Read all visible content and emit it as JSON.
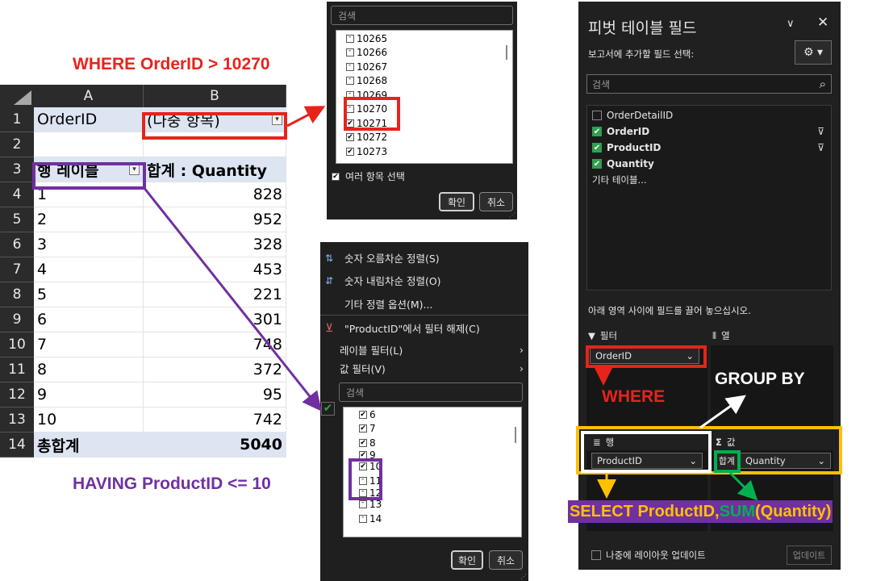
{
  "annotations": {
    "where_title": "WHERE OrderID > 10270",
    "having_title": "HAVING ProductID <= 10",
    "where_label": "WHERE",
    "group_by_label": "GROUP BY",
    "select_prefix": "SELECT ProductID, ",
    "select_sum": "SUM",
    "select_suffix": "(Quantity)",
    "colors": {
      "red": "#e8231b",
      "purple": "#7030a0",
      "amber": "#ffc000",
      "green": "#00b050",
      "white": "#ffffff"
    }
  },
  "grid": {
    "columns": [
      "A",
      "B"
    ],
    "rows": [
      "1",
      "2",
      "3",
      "4",
      "5",
      "6",
      "7",
      "8",
      "9",
      "10",
      "11",
      "12",
      "13",
      "14"
    ],
    "filter_label": "OrderID",
    "filter_value": "(다중 항목)",
    "row_labels_header": "행 레이블",
    "sum_header": "합계 : Quantity",
    "data": [
      {
        "label": "1",
        "value": "828"
      },
      {
        "label": "2",
        "value": "952"
      },
      {
        "label": "3",
        "value": "328"
      },
      {
        "label": "4",
        "value": "453"
      },
      {
        "label": "5",
        "value": "221"
      },
      {
        "label": "6",
        "value": "301"
      },
      {
        "label": "7",
        "value": "748"
      },
      {
        "label": "8",
        "value": "372"
      },
      {
        "label": "9",
        "value": "95"
      },
      {
        "label": "10",
        "value": "742"
      }
    ],
    "total_label": "총합계",
    "total_value": "5040"
  },
  "orderid_popup": {
    "search_placeholder": "검색",
    "items": [
      {
        "label": "10265",
        "checked": false
      },
      {
        "label": "10266",
        "checked": false
      },
      {
        "label": "10267",
        "checked": false
      },
      {
        "label": "10268",
        "checked": false
      },
      {
        "label": "10269",
        "checked": false
      },
      {
        "label": "10270",
        "checked": false
      },
      {
        "label": "10271",
        "checked": true
      },
      {
        "label": "10272",
        "checked": true
      },
      {
        "label": "10273",
        "checked": true
      }
    ],
    "multi_select_label": "여러 항목 선택",
    "ok_label": "확인",
    "cancel_label": "취소"
  },
  "product_popup": {
    "sort_asc": "숫자 오름차순 정렬(S)",
    "sort_desc": "숫자 내림차순 정렬(O)",
    "more_sort": "기타 정렬 옵션(M)...",
    "clear_filter": "\"ProductID\"에서 필터 해제(C)",
    "label_filter": "레이블 필터(L)",
    "value_filter": "값 필터(V)",
    "search_placeholder": "검색",
    "items": [
      {
        "label": "6",
        "checked": true
      },
      {
        "label": "7",
        "checked": true
      },
      {
        "label": "8",
        "checked": true
      },
      {
        "label": "9",
        "checked": true
      },
      {
        "label": "10",
        "checked": true
      },
      {
        "label": "11",
        "checked": false
      },
      {
        "label": "12",
        "checked": false
      },
      {
        "label": "13",
        "checked": false
      },
      {
        "label": "14",
        "checked": false
      }
    ],
    "ok_label": "확인",
    "cancel_label": "취소"
  },
  "pane": {
    "title": "피벗 테이블 필드",
    "subtitle": "보고서에 추가할 필드 선택:",
    "search_placeholder": "검색",
    "fields": [
      {
        "label": "OrderDetailID",
        "checked": false,
        "bold": false
      },
      {
        "label": "OrderID",
        "checked": true,
        "bold": true
      },
      {
        "label": "ProductID",
        "checked": true,
        "bold": true
      },
      {
        "label": "Quantity",
        "checked": true,
        "bold": true
      }
    ],
    "more_tables": "기타 테이블...",
    "drag_hint": "아래 영역 사이에 필드를 끌어 놓으십시오.",
    "filters_label": "필터",
    "columns_label": "열",
    "rows_label": "행",
    "values_label": "값",
    "filter_chip": "OrderID",
    "row_chip": "ProductID",
    "value_chip": "Quantity",
    "sum_tag": "합계",
    "defer_label": "나중에 레이아웃 업데이트",
    "update_label": "업데이트"
  }
}
